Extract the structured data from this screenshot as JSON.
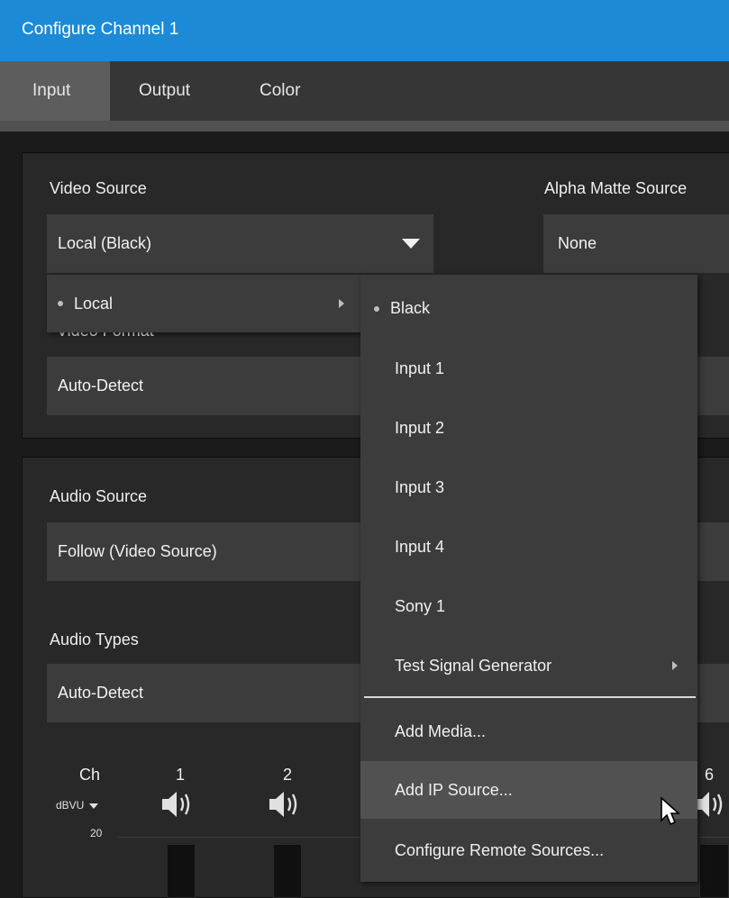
{
  "window": {
    "title": "Configure Channel 1"
  },
  "tabs": [
    {
      "label": "Input",
      "active": true
    },
    {
      "label": "Output",
      "active": false
    },
    {
      "label": "Color",
      "active": false
    }
  ],
  "video": {
    "source_label": "Video Source",
    "source_value": "Local (Black)",
    "alpha_label": "Alpha Matte Source",
    "alpha_value": "None",
    "format_label": "Video Format",
    "format_value": "Auto-Detect"
  },
  "audio": {
    "source_label": "Audio Source",
    "source_value": "Follow (Video Source)",
    "types_label": "Audio Types",
    "types_value": "Auto-Detect"
  },
  "menu": {
    "parent_item": "Local",
    "submenu_items": [
      "Black",
      "Input 1",
      "Input 2",
      "Input 3",
      "Input 4",
      "Sony 1",
      "Test Signal Generator"
    ],
    "action_items": [
      "Add Media...",
      "Add IP Source...",
      "Configure Remote Sources..."
    ],
    "selected": "Black",
    "hovered": "Add IP Source..."
  },
  "mixer": {
    "ch_label": "Ch",
    "unit": "dBVU",
    "scale_top": "20",
    "channels": [
      "1",
      "2",
      "6"
    ]
  },
  "icons": [
    "chevron-down-icon",
    "submenu-arrow-icon",
    "speaker-icon",
    "mouse-cursor-icon"
  ],
  "colors": {
    "titlebar": "#1c8ad6",
    "panel": "#282828",
    "field": "#3c3c3c",
    "menu": "#3c3c3c",
    "menu_hover": "#515151"
  }
}
